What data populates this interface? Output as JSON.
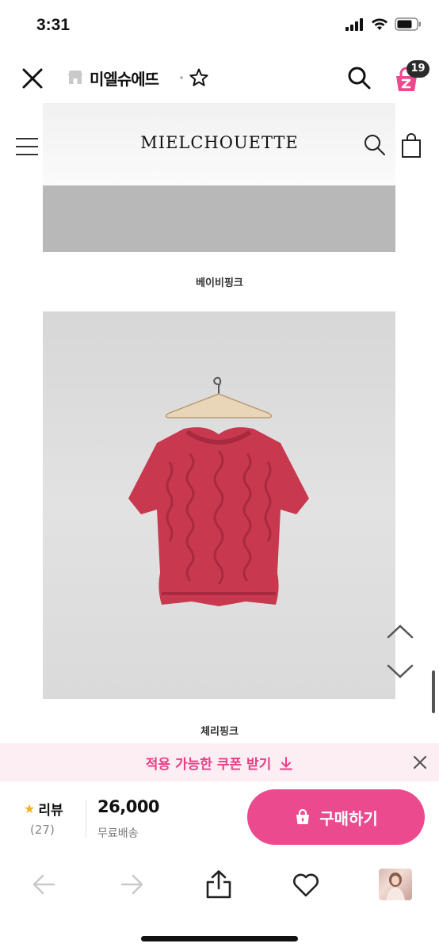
{
  "status_bar": {
    "time": "3:31"
  },
  "app_bar": {
    "store_name": "미엘슈에뜨",
    "cart_count": "19"
  },
  "store_page": {
    "logo": "MIELCHOUETTE",
    "captions": [
      "베이비핑크",
      "체리핑크"
    ]
  },
  "coupon_banner": {
    "text": "적용 가능한 쿠폰 받기"
  },
  "purchase_bar": {
    "review_label": "리뷰",
    "review_count": "(27)",
    "price": "26,000",
    "shipping": "무료배송",
    "buy_label": "구매하기"
  },
  "colors": {
    "accent": "#ec4a8e",
    "coupon_bg": "#fdeef4",
    "coupon_text": "#ea3d86",
    "sweater": "#c8394f"
  },
  "icons": [
    "close-icon",
    "store-icon",
    "star-icon",
    "search-icon",
    "cart-icon",
    "hamburger-icon",
    "bag-icon",
    "chevron-up-icon",
    "chevron-down-icon",
    "download-icon",
    "lock-bag-icon",
    "back-arrow-icon",
    "forward-arrow-icon",
    "share-icon",
    "heart-icon"
  ]
}
